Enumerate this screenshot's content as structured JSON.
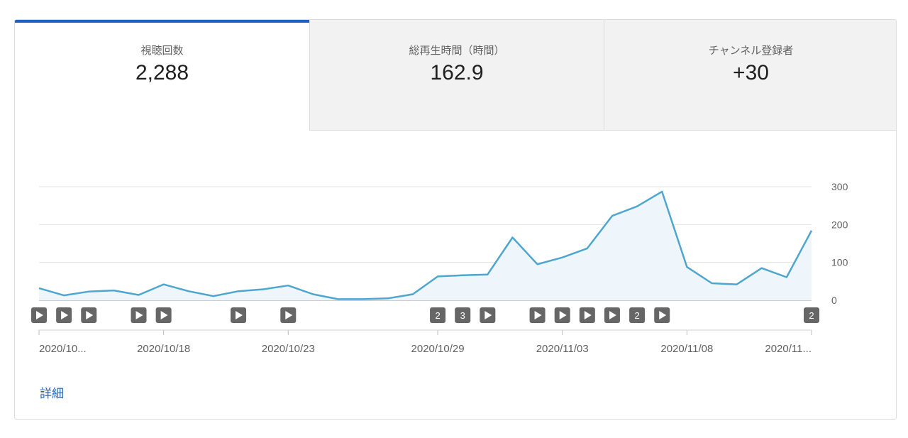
{
  "tabs": [
    {
      "label": "視聴回数",
      "value": "2,288",
      "active": true
    },
    {
      "label": "総再生時間（時間）",
      "value": "162.9",
      "active": false
    },
    {
      "label": "チャンネル登録者",
      "value": "+30",
      "active": false
    }
  ],
  "more_link": "詳細",
  "colors": {
    "line": "#4ea6cf",
    "area": "#eef6fb",
    "active_tab": "#1f5fc6",
    "link": "#1a66c4",
    "marker": "#666666"
  },
  "chart_data": {
    "type": "area",
    "x": [
      "2020/10/13",
      "2020/10/14",
      "2020/10/15",
      "2020/10/16",
      "2020/10/17",
      "2020/10/18",
      "2020/10/19",
      "2020/10/20",
      "2020/10/21",
      "2020/10/22",
      "2020/10/23",
      "2020/10/24",
      "2020/10/25",
      "2020/10/26",
      "2020/10/27",
      "2020/10/28",
      "2020/10/29",
      "2020/10/30",
      "2020/10/31",
      "2020/11/01",
      "2020/11/02",
      "2020/11/03",
      "2020/11/04",
      "2020/11/05",
      "2020/11/06",
      "2020/11/07",
      "2020/11/08",
      "2020/11/09",
      "2020/11/10",
      "2020/11/11",
      "2020/11/12",
      "2020/11/13"
    ],
    "values": [
      32,
      13,
      23,
      26,
      14,
      42,
      24,
      11,
      24,
      29,
      39,
      16,
      3,
      3,
      5,
      16,
      63,
      66,
      68,
      166,
      95,
      113,
      137,
      223,
      248,
      287,
      88,
      45,
      42,
      85,
      61,
      184
    ],
    "y_ticks": [
      "0",
      "100",
      "200",
      "300"
    ],
    "ylim": [
      0,
      300
    ],
    "y_axis_position": "right",
    "x_tick_labels": [
      {
        "date": "2020/10/13",
        "label": "2020/10..."
      },
      {
        "date": "2020/10/18",
        "label": "2020/10/18"
      },
      {
        "date": "2020/10/23",
        "label": "2020/10/23"
      },
      {
        "date": "2020/10/29",
        "label": "2020/10/29"
      },
      {
        "date": "2020/11/03",
        "label": "2020/11/03"
      },
      {
        "date": "2020/11/08",
        "label": "2020/11/08"
      },
      {
        "date": "2020/11/13",
        "label": "2020/11..."
      }
    ],
    "upload_markers": [
      {
        "date": "2020/10/13",
        "type": "play"
      },
      {
        "date": "2020/10/14",
        "type": "play"
      },
      {
        "date": "2020/10/15",
        "type": "play"
      },
      {
        "date": "2020/10/17",
        "type": "play"
      },
      {
        "date": "2020/10/18",
        "type": "play"
      },
      {
        "date": "2020/10/21",
        "type": "play"
      },
      {
        "date": "2020/10/23",
        "type": "play"
      },
      {
        "date": "2020/10/29",
        "type": "count",
        "count": "2"
      },
      {
        "date": "2020/10/30",
        "type": "count",
        "count": "3"
      },
      {
        "date": "2020/10/31",
        "type": "play"
      },
      {
        "date": "2020/11/02",
        "type": "play"
      },
      {
        "date": "2020/11/03",
        "type": "play"
      },
      {
        "date": "2020/11/04",
        "type": "play"
      },
      {
        "date": "2020/11/05",
        "type": "play"
      },
      {
        "date": "2020/11/06",
        "type": "count",
        "count": "2"
      },
      {
        "date": "2020/11/07",
        "type": "play"
      },
      {
        "date": "2020/11/13",
        "type": "count",
        "count": "2"
      }
    ],
    "grid": true,
    "title": "",
    "xlabel": "",
    "ylabel": ""
  }
}
